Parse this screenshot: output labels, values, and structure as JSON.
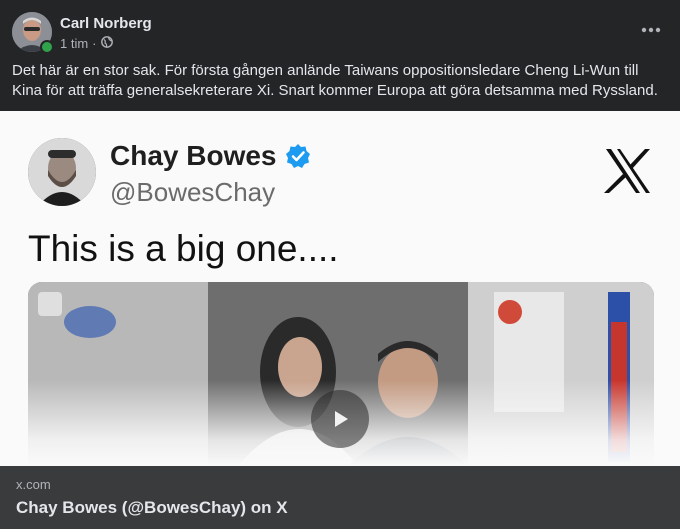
{
  "post": {
    "author": "Carl Norberg",
    "time": "1 tim",
    "separator": "·",
    "privacy_icon": "globe-icon",
    "more_icon": "more-options-icon",
    "text": "Det här är en stor sak. För första gången anlände Taiwans oppositionsledare Cheng Li-Wun till Kina för att träffa generalsekreterare Xi. Snart kommer Europa att göra detsamma med Ryssland."
  },
  "preview": {
    "tweet_name": "Chay Bowes",
    "tweet_handle": "@BowesChay",
    "tweet_text": "This is a big one....",
    "verified_icon": "verified-badge-icon",
    "platform_logo": "x-logo",
    "play_icon": "play-icon"
  },
  "link": {
    "domain": "x.com",
    "title": "Chay Bowes (@BowesChay) on X"
  },
  "colors": {
    "background": "#242526",
    "link_footer": "#3a3b3c",
    "online": "#31a24c",
    "verified": "#1d9bf0"
  }
}
